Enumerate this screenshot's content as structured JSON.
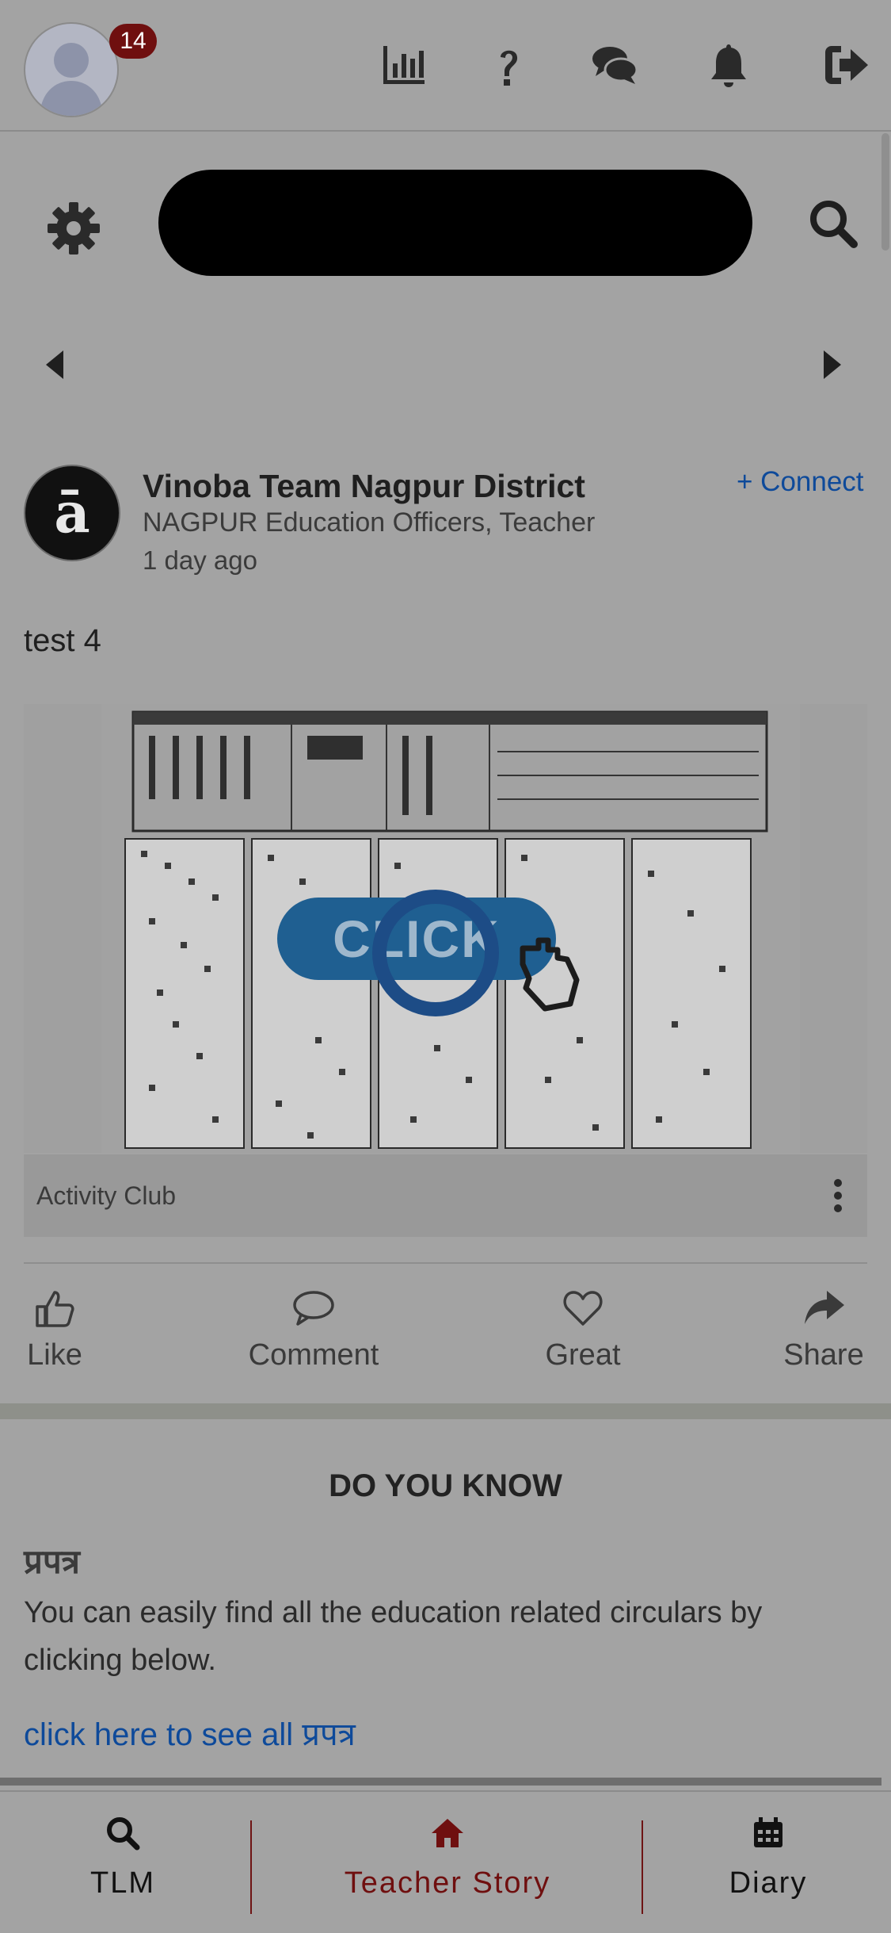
{
  "header": {
    "notification_count": "14",
    "icons": [
      "stats-icon",
      "help-icon",
      "chat-icon",
      "bell-icon",
      "logout-icon"
    ]
  },
  "post": {
    "author": "Vinoba Team Nagpur District",
    "role": "NAGPUR Education Officers, Teacher",
    "time": "1 day ago",
    "connect_label": "+ Connect",
    "text": "test 4",
    "image_overlay_text": "CLICK",
    "club_label": "Activity Club",
    "actions": {
      "like": "Like",
      "comment": "Comment",
      "great": "Great",
      "share": "Share"
    }
  },
  "do_you_know": {
    "title": "DO YOU KNOW",
    "subtitle": "प्रपत्र",
    "body": "You can easily find all the education related circulars by clicking below.",
    "link": "click here to see all प्रपत्र"
  },
  "bottom_nav": {
    "tlm": "TLM",
    "teacher_story": "Teacher Story",
    "diary": "Diary"
  },
  "colors": {
    "accent_dark_red": "#6f0f0f",
    "link_blue": "#0e4a9a",
    "overlay_grey": "#a3a3a3"
  }
}
